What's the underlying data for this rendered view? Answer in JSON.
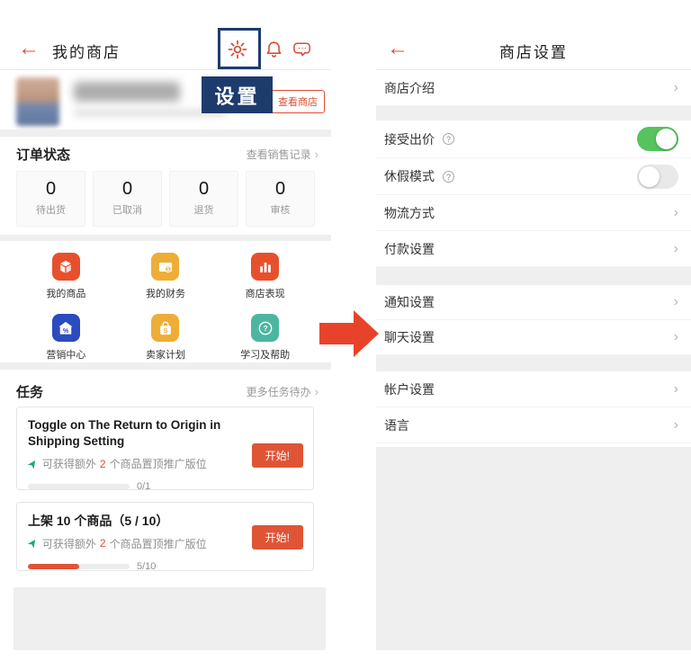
{
  "ui": {
    "back_arrow": "←",
    "chevron": "›",
    "help_glyph": "?"
  },
  "colors": {
    "accent": "#e05436",
    "navy": "#1d3c6d",
    "toggle_on_green": "#55c45f",
    "icon_red": "#e8502d",
    "icon_amber": "#eead36",
    "icon_blue": "#2b4bc0",
    "icon_teal": "#4db6a0"
  },
  "left": {
    "title": "我的商店",
    "tooltip_label": "设置",
    "view_shop": "查看商店",
    "order_status": {
      "title": "订单状态",
      "link": "查看销售记录",
      "stats": [
        {
          "count": "0",
          "label": "待出货"
        },
        {
          "count": "0",
          "label": "已取消"
        },
        {
          "count": "0",
          "label": "退货"
        },
        {
          "count": "0",
          "label": "审核"
        }
      ]
    },
    "menu": [
      {
        "label": "我的商品",
        "icon": "products-icon"
      },
      {
        "label": "我的财务",
        "icon": "finance-icon"
      },
      {
        "label": "商店表现",
        "icon": "performance-icon"
      },
      {
        "label": "营销中心",
        "icon": "marketing-icon"
      },
      {
        "label": "卖家计划",
        "icon": "seller-plan-icon"
      },
      {
        "label": "学习及帮助",
        "icon": "learn-help-icon"
      }
    ],
    "tasks": {
      "title": "任务",
      "link": "更多任务待办",
      "cards": [
        {
          "title": "Toggle on The Return to Origin in Shipping Setting",
          "reward_prefix": "可获得额外",
          "reward_count": "2",
          "reward_suffix": "个商品置顶推广版位",
          "button": "开始!",
          "progress_label": "0/1",
          "progress_pct": 0
        },
        {
          "title": "上架 10 个商品（5 / 10）",
          "reward_prefix": "可获得额外",
          "reward_count": "2",
          "reward_suffix": "个商品置顶推广版位",
          "button": "开始!",
          "progress_label": "5/10",
          "progress_pct": 50
        }
      ]
    }
  },
  "right": {
    "title": "商店设置",
    "rows": [
      {
        "label": "商店介绍"
      },
      {
        "label": "接受出价"
      },
      {
        "label": "休假模式"
      },
      {
        "label": "物流方式"
      },
      {
        "label": "付款设置"
      },
      {
        "label": "通知设置"
      },
      {
        "label": "聊天设置"
      },
      {
        "label": "帐户设置"
      },
      {
        "label": "语言"
      }
    ]
  }
}
